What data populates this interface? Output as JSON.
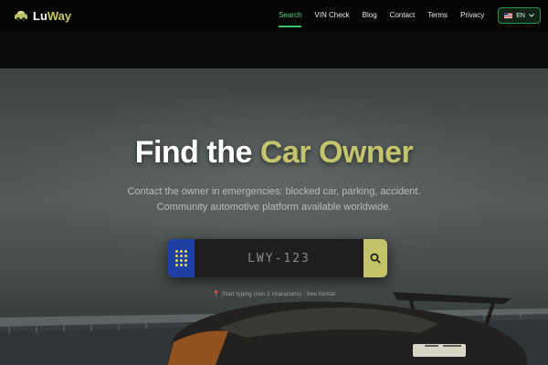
{
  "brand": {
    "part1": "Lu",
    "part2": "Way"
  },
  "nav": {
    "items": [
      {
        "label": "Search",
        "active": true
      },
      {
        "label": "VIN Check",
        "active": false
      },
      {
        "label": "Blog",
        "active": false
      },
      {
        "label": "Contact",
        "active": false
      },
      {
        "label": "Terms",
        "active": false
      },
      {
        "label": "Privacy",
        "active": false
      }
    ],
    "language": {
      "label": "EN",
      "flag": "us-flag-icon"
    }
  },
  "hero": {
    "title_white": "Find the",
    "title_accent": "Car Owner",
    "subtitle_line1": "Contact the owner in emergencies: blocked car, parking, accident.",
    "subtitle_line2": "Community automotive platform available worldwide."
  },
  "search": {
    "placeholder": "LWY-123",
    "hint": "Start typing (min 2 characters) - free format"
  },
  "colors": {
    "accent": "#c3c46e",
    "nav_active": "#59d27e",
    "eu_band": "#1d3fa6",
    "background": "#0a0a0a"
  }
}
